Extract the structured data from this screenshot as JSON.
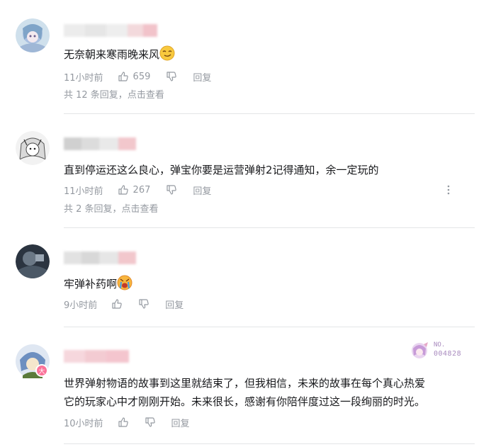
{
  "comments": [
    {
      "text": "无奈朝来寒雨晚来风",
      "time": "11小时前",
      "likes": "659",
      "reply_label": "回复",
      "replies_summary": "共 12 条回复，",
      "view_label": "点击查看",
      "emoji": "smirk-face-emoji"
    },
    {
      "text": "直到停运还这么良心，弹宝你要是运营弹射2记得通知，余一定玩的",
      "time": "11小时前",
      "likes": "267",
      "reply_label": "回复",
      "replies_summary": "共 2 条回复，",
      "view_label": "点击查看"
    },
    {
      "text": "牢弹补药啊",
      "time": "9小时前",
      "likes": "",
      "reply_label": "回复",
      "emoji": "crying-face-emoji"
    },
    {
      "text_line1": "世界弹射物语的故事到这里就结束了，但我相信，未来的故事在每个真心热爱",
      "text_line2": "它的玩家心中才刚刚开始。未来很长，感谢有你陪伴度过这一段绚丽的时光。",
      "time": "10小时前",
      "likes": "",
      "reply_label": "回复",
      "badge_text_top": "NO.",
      "badge_text_bottom": "004828"
    }
  ],
  "colors": {
    "meta": "#9499a0",
    "divider": "#e3e5e7",
    "text": "#18191c"
  }
}
